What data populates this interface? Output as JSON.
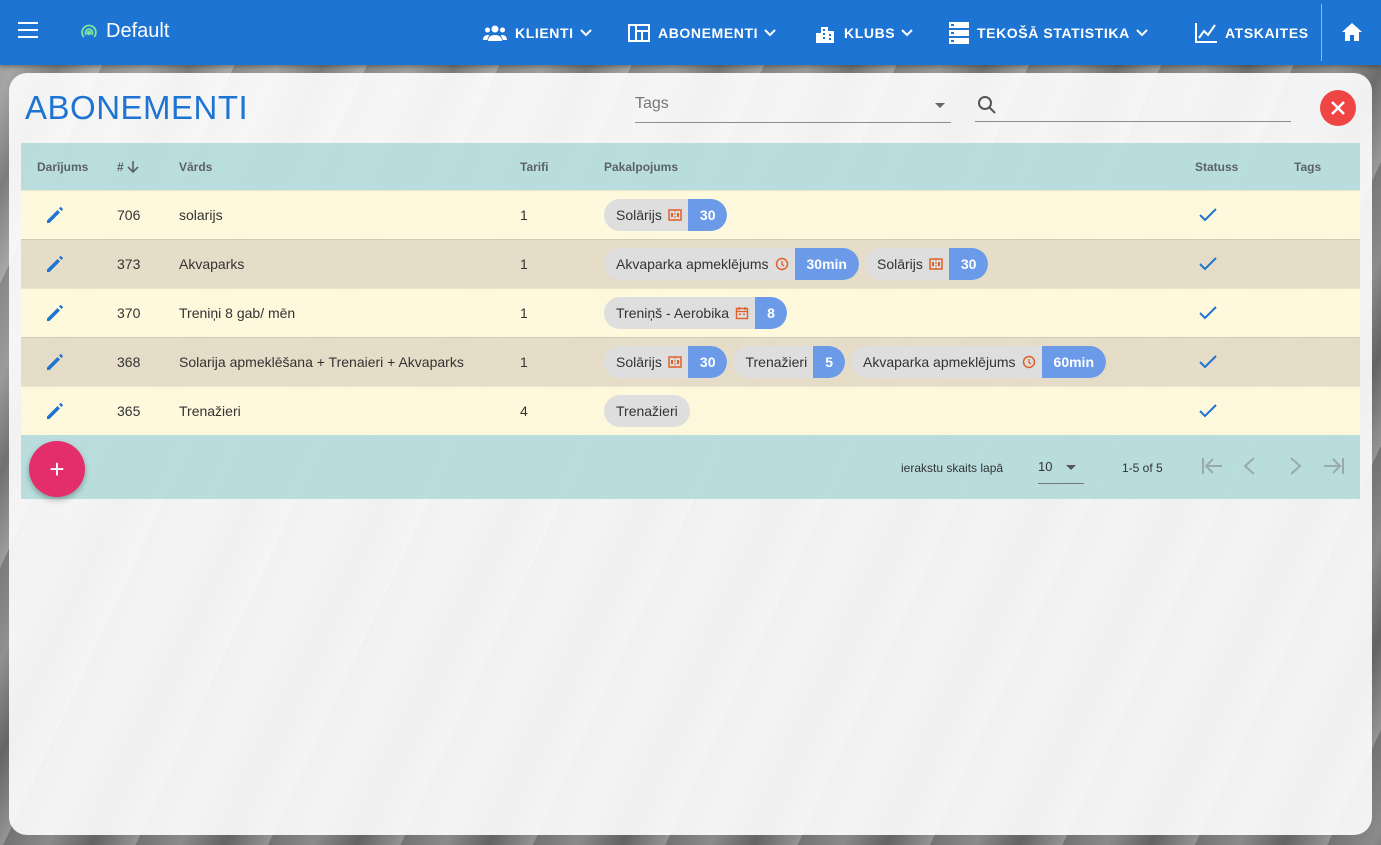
{
  "topbar": {
    "brand": "Default",
    "nav": [
      {
        "label": "KLIENTI",
        "icon": "users-icon"
      },
      {
        "label": "ABONEMENTI",
        "icon": "table-icon"
      },
      {
        "label": "KLUBS",
        "icon": "building-icon"
      },
      {
        "label": "TEKOŠĀ STATISTIKA",
        "icon": "server-icon"
      },
      {
        "label": "ATSKAITES",
        "icon": "chart-icon"
      }
    ]
  },
  "page": {
    "title": "ABONEMENTI",
    "tags_label": "Tags",
    "search_value": ""
  },
  "table": {
    "headers": {
      "action": "Darījums",
      "id": "#",
      "name": "Vārds",
      "tariff": "Tarifi",
      "services": "Pakalpojums",
      "status": "Statuss",
      "tags": "Tags"
    },
    "rows": [
      {
        "id": "706",
        "name": "solarijs",
        "tariff": "1",
        "services": [
          {
            "label": "Solārijs",
            "icon": "ticket-icon",
            "value": "30"
          }
        ]
      },
      {
        "id": "373",
        "name": "Akvaparks",
        "tariff": "1",
        "services": [
          {
            "label": "Akvaparka apmeklējums",
            "icon": "clock-icon",
            "value": "30min"
          },
          {
            "label": "Solārijs",
            "icon": "ticket-icon",
            "value": "30"
          }
        ]
      },
      {
        "id": "370",
        "name": "Treniņi 8 gab/ mēn",
        "tariff": "1",
        "services": [
          {
            "label": "Treniņš - Aerobika",
            "icon": "calendar-icon",
            "value": "8"
          }
        ]
      },
      {
        "id": "368",
        "name": "Solarija apmeklēšana + Trenaieri + Akvaparks",
        "tariff": "1",
        "services": [
          {
            "label": "Solārijs",
            "icon": "ticket-icon",
            "value": "30"
          },
          {
            "label": "Trenažieri",
            "icon": "",
            "value": "5"
          },
          {
            "label": "Akvaparka apmeklējums",
            "icon": "clock-icon",
            "value": "60min"
          }
        ]
      },
      {
        "id": "365",
        "name": "Trenažieri",
        "tariff": "4",
        "services": [
          {
            "label": "Trenažieri",
            "icon": "",
            "value": ""
          }
        ]
      }
    ]
  },
  "footer": {
    "per_page_label": "ierakstu skaits lapā",
    "per_page_value": "10",
    "range": "1-5 of 5",
    "fab_label": "+"
  }
}
